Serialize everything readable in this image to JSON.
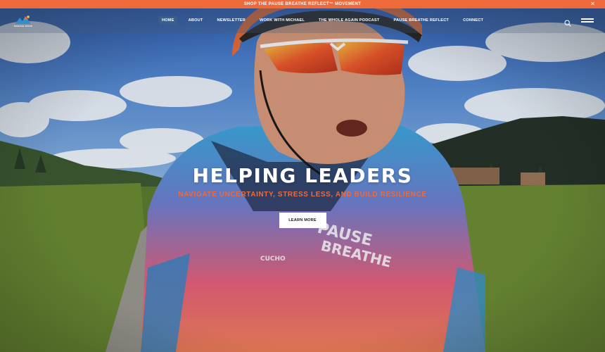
{
  "promo": {
    "text": "SHOP THE PAUSE BREATHE REFLECT™ MOVEMENT",
    "close_icon": "close-icon"
  },
  "header": {
    "logo_text": "MICHAEL DAVIS",
    "nav": [
      {
        "label": "HOME",
        "active": true
      },
      {
        "label": "ABOUT"
      },
      {
        "label": "NEWSLETTER"
      },
      {
        "label": "WORK WITH MICHAEL"
      },
      {
        "label": "THE WHOLE AGAIN PODCAST"
      },
      {
        "label": "PAUSE BREATHE REFLECT"
      },
      {
        "label": "CONNECT"
      }
    ],
    "icons": [
      "search-icon",
      "hamburger-menu-icon"
    ]
  },
  "hero": {
    "title": "HELPING LEADERS",
    "subtitle": "NAVIGATE UNCERTAINTY, STRESS LESS, AND BUILD RESILIENCE",
    "cta_label": "LEARN MORE"
  },
  "colors": {
    "accent": "#ef6a3b",
    "active_nav": "#3b5f8c",
    "sky": "#3a6cc0"
  }
}
